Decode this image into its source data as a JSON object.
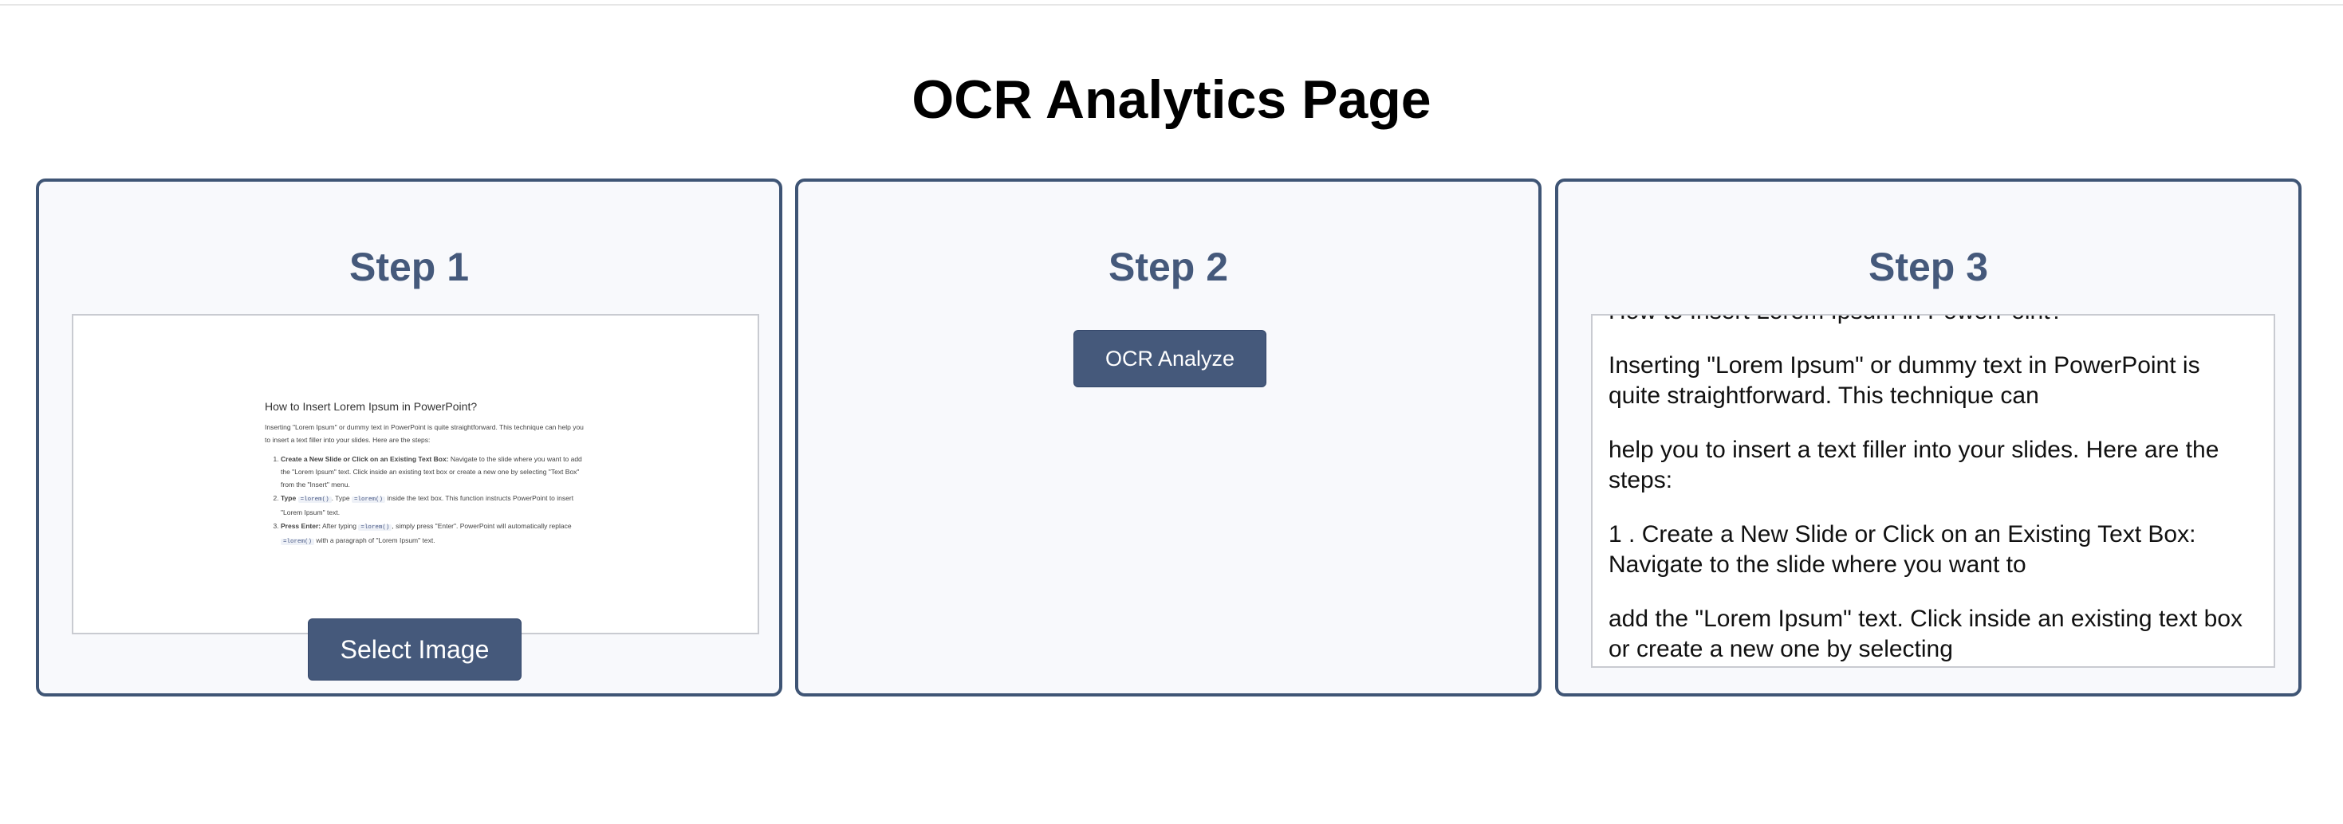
{
  "page": {
    "title": "OCR Analytics Page"
  },
  "step1": {
    "heading": "Step 1",
    "select_button": "Select Image",
    "preview_doc": {
      "title": "How to Insert Lorem Ipsum in PowerPoint?",
      "intro": "Inserting \"Lorem Ipsum\" or dummy text in PowerPoint is quite straightforward. This technique can help you to insert a text filler into your slides. Here are the steps:",
      "items": [
        {
          "bold": "Create a New Slide or Click on an Existing Text Box:",
          "text": " Navigate to the slide where you want to add the \"Lorem Ipsum\" text. Click inside an existing text box or create a new one by selecting \"Text Box\" from the \"Insert\" menu."
        },
        {
          "bold": "Type",
          "code1": "=lorem()",
          "mid": ". Type ",
          "code2": "=lorem()",
          "text": " inside the text box. This function instructs PowerPoint to insert \"Lorem Ipsum\" text."
        },
        {
          "bold": "Press Enter:",
          "pre": " After typing ",
          "code1": "=lorem()",
          "text": ", simply press \"Enter\". PowerPoint will automatically replace ",
          "code2": "=lorem()",
          "post": " with a paragraph of \"Lorem Ipsum\" text."
        }
      ]
    }
  },
  "step2": {
    "heading": "Step 2",
    "analyze_button": "OCR Analyze"
  },
  "step3": {
    "heading": "Step 3",
    "lines": [
      "How to Insert Lorem Ipsum in PowerPoint?",
      "Inserting \"Lorem Ipsum\" or dummy text in PowerPoint is quite straightforward. This technique can",
      "help you to insert a text filler into your slides. Here are the steps:",
      "1 . Create a New Slide or Click on an Existing Text Box: Navigate to the slide where you want to",
      "add the \"Lorem Ipsum\" text. Click inside an existing text box or create a new one by selecting"
    ]
  }
}
